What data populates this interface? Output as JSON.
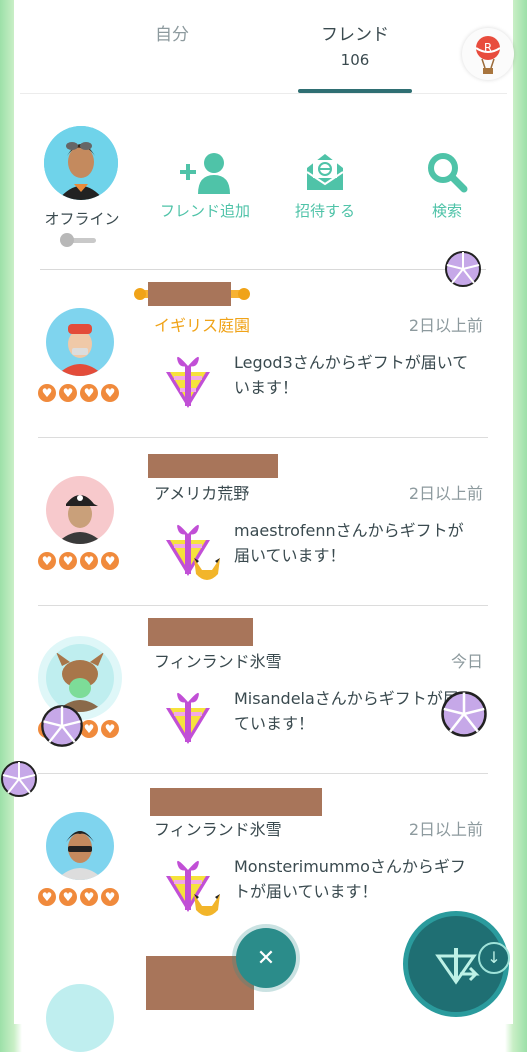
{
  "tabs": {
    "self_label": "自分",
    "friends_label": "フレンド",
    "friends_count": "106"
  },
  "header": {
    "status_label": "オフライン",
    "actions": [
      {
        "label": "フレンド追加",
        "icon": "add-friend-icon"
      },
      {
        "label": "招待する",
        "icon": "invite-envelope-icon"
      },
      {
        "label": "検索",
        "icon": "search-icon"
      }
    ]
  },
  "friends": [
    {
      "location": "イギリス庭園",
      "time": "2日以上前",
      "message": "Legod3さんからギフトが届いています！",
      "best_friend": true,
      "avatar_bg": "#7fd4ee"
    },
    {
      "location": "アメリカ荒野",
      "time": "2日以上前",
      "message": "maestrofennさんからギフトが届いています！",
      "best_friend": false,
      "avatar_bg": "#f7c9cc"
    },
    {
      "location": "フィンランド氷雪",
      "time": "今日",
      "message": "Misandelaさんからギフトが届いています！",
      "best_friend": false,
      "avatar_bg": "#bfeeef"
    },
    {
      "location": "フィンランド氷雪",
      "time": "2日以上前",
      "message": "Monsterimummoさんからギフトが届いています！",
      "best_friend": false,
      "avatar_bg": "#7fd4ee"
    }
  ],
  "colors": {
    "accent": "#4fc3a8",
    "heart": "#f08a3c",
    "gold": "#f0a318",
    "fab": "#1f6f73"
  }
}
